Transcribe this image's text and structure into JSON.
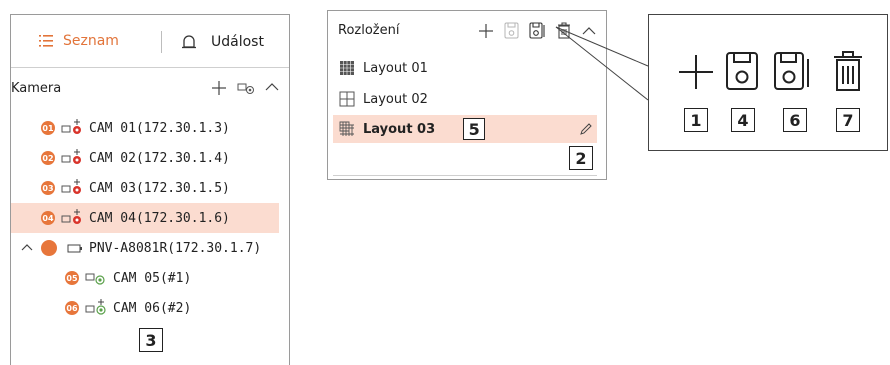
{
  "tabs": {
    "list_label": "Seznam",
    "event_label": "Událost"
  },
  "camera": {
    "header": "Kamera",
    "items": [
      {
        "badge": "01",
        "label": "CAM 01(172.30.1.3)"
      },
      {
        "badge": "02",
        "label": "CAM 02(172.30.1.4)"
      },
      {
        "badge": "03",
        "label": "CAM 03(172.30.1.5)"
      },
      {
        "badge": "04",
        "label": "CAM 04(172.30.1.6)"
      }
    ],
    "group": {
      "label": "PNV-A8081R(172.30.1.7)"
    },
    "subitems": [
      {
        "badge": "05",
        "label": "CAM 05(#1)"
      },
      {
        "badge": "06",
        "label": "CAM 06(#2)"
      }
    ]
  },
  "layout": {
    "header": "Rozložení",
    "items": [
      {
        "label": "Layout 01"
      },
      {
        "label": "Layout 02"
      },
      {
        "label": "Layout 03"
      }
    ]
  },
  "callouts": {
    "c1": "1",
    "c2": "2",
    "c3": "3",
    "c4": "4",
    "c5": "5",
    "c6": "6",
    "c7": "7"
  },
  "colors": {
    "accent": "#e7763b",
    "selected_bg": "#fbdcd0"
  },
  "icons": [
    "list-icon",
    "bell-icon",
    "add-icon",
    "add-camera-icon",
    "collapse-icon",
    "camera-icon",
    "save-icon",
    "save-as-icon",
    "delete-icon",
    "edit-icon",
    "layout-grid-icon"
  ]
}
